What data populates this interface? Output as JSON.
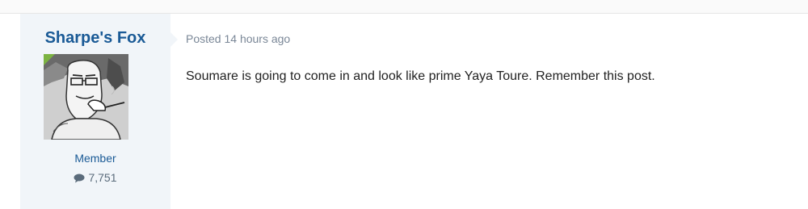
{
  "author": {
    "name": "Sharpe's Fox",
    "title": "Member",
    "post_count": "7,751"
  },
  "post": {
    "meta": "Posted 14 hours ago",
    "body": "Soumare is going to come in and look like prime Yaya Toure. Remember this post."
  },
  "colors": {
    "author_link": "#1a5a96",
    "panel_bg": "#f1f5f9",
    "online_indicator": "#7cb342"
  },
  "icons": {
    "post_count": "comment-icon",
    "online": "online-indicator"
  }
}
